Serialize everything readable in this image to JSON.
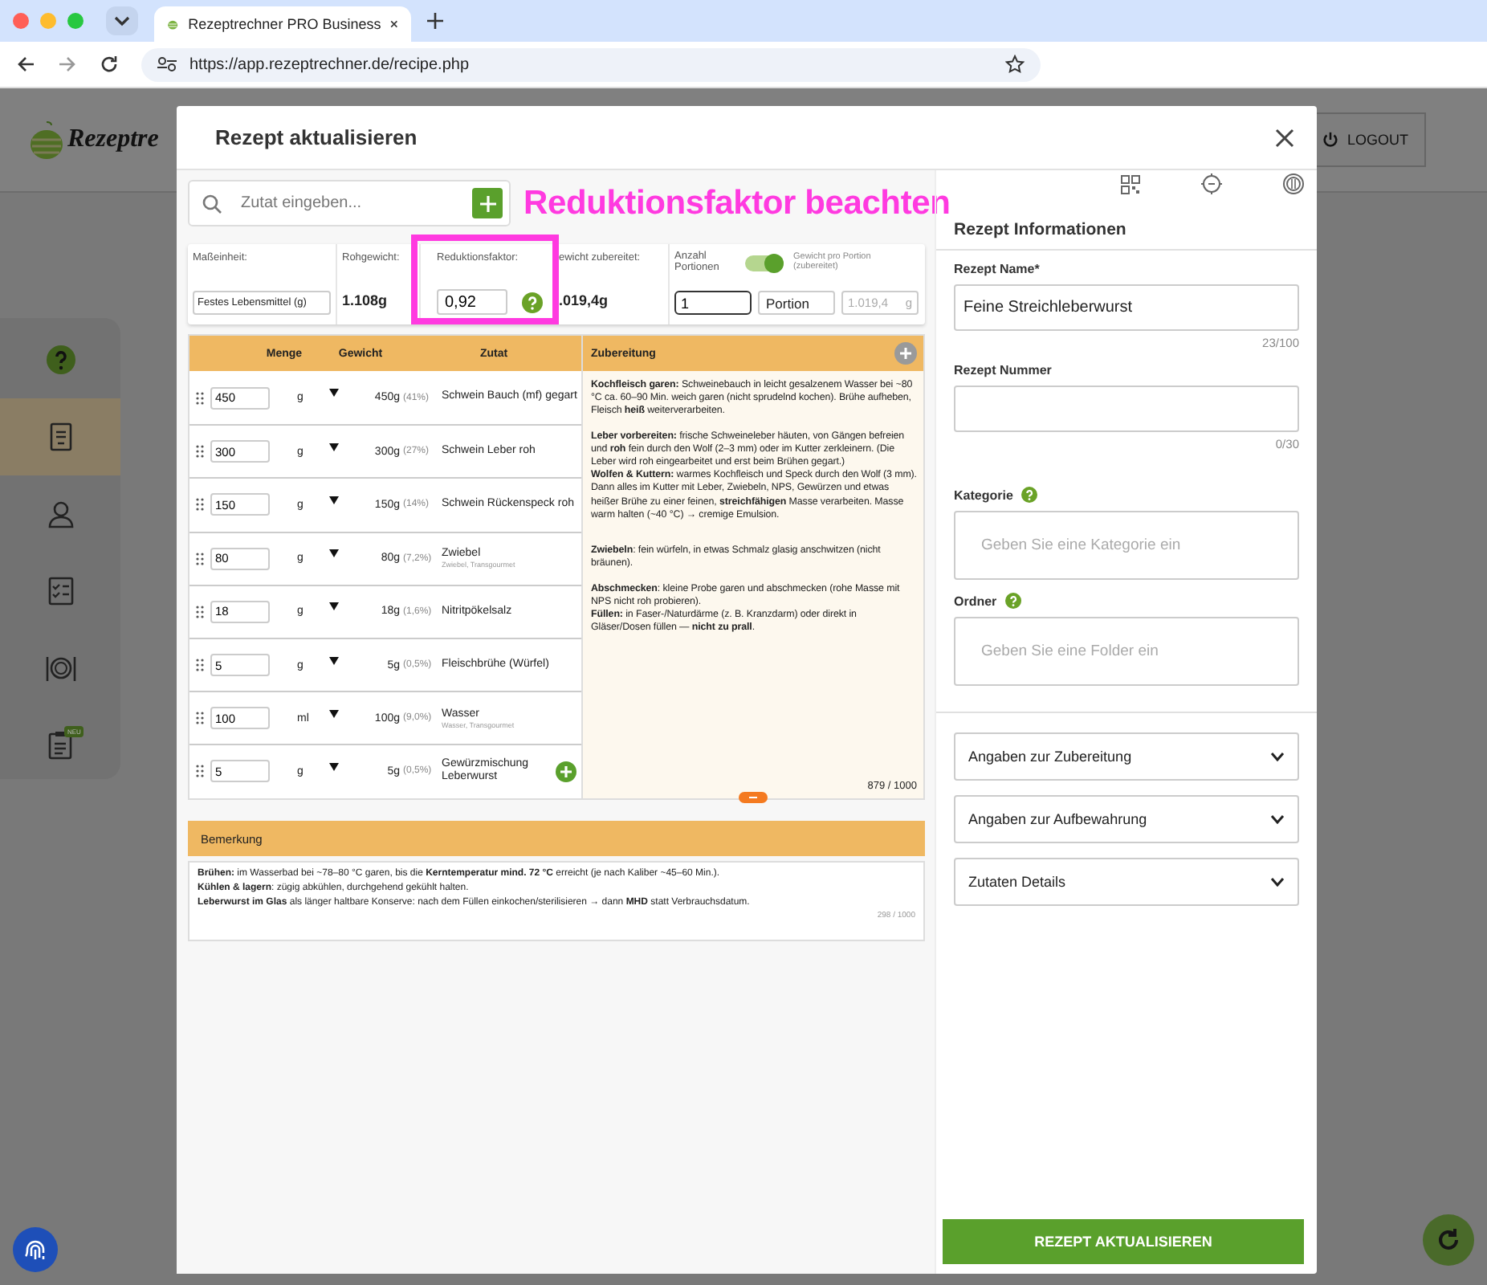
{
  "browser": {
    "tab_title": "Rezeptrechner PRO Business",
    "url": "https://app.rezeptrechner.de/recipe.php"
  },
  "app": {
    "logo_text": "Rezeptre",
    "logout": "LOGOUT",
    "sidebar": [
      {
        "selected": false
      },
      {
        "selected": true
      },
      {
        "selected": false
      },
      {
        "selected": false
      },
      {
        "selected": false
      },
      {
        "selected": false,
        "badge": "NEU"
      }
    ]
  },
  "modal": {
    "title": "Rezept aktualisieren",
    "search": {
      "placeholder": "Zutat eingeben..."
    },
    "annotation": "Reduktionsfaktor beachten",
    "summary": {
      "unit_label": "Maßeinheit:",
      "unit_value": "Festes Lebensmittel (g)",
      "raw_label": "Rohgewicht:",
      "raw_value": "1.108g",
      "factor_label": "Reduktionsfaktor:",
      "factor_value": "0,92",
      "factor_highlighted": true,
      "cooked_label": "ewicht zubereitet:",
      "cooked_value": ".019,4g",
      "portions_label": "Anzahl Portionen",
      "per_portion": {
        "on": true,
        "label": "Gewicht pro Portion (zubereitet)"
      },
      "portions_value": "1",
      "portion_unit": "Portion",
      "portion_weight": "1.019,4",
      "portion_weight_unit": "g"
    },
    "ingredients": {
      "columns": [
        "Menge",
        "Gewicht",
        "Zutat"
      ],
      "rows": [
        {
          "amount": "450",
          "unit": "g",
          "weight": "450g",
          "percent": "(41%)",
          "name": "Schwein Bauch (mf) gegart"
        },
        {
          "amount": "300",
          "unit": "g",
          "weight": "300g",
          "percent": "(27%)",
          "name": "Schwein Leber roh"
        },
        {
          "amount": "150",
          "unit": "g",
          "weight": "150g",
          "percent": "(14%)",
          "name": "Schwein Rückenspeck roh"
        },
        {
          "amount": "80",
          "unit": "g",
          "weight": "80g",
          "percent": "(7,2%)",
          "name": "Zwiebel",
          "source": "Zwiebel, Transgourmet"
        },
        {
          "amount": "18",
          "unit": "g",
          "weight": "18g",
          "percent": "(1,6%)",
          "name": "Nitritpökelsalz"
        },
        {
          "amount": "5",
          "unit": "g",
          "weight": "5g",
          "percent": "(0,5%)",
          "name": "Fleischbrühe (Würfel)"
        },
        {
          "amount": "100",
          "unit": "ml",
          "weight": "100g",
          "percent": "(9,0%)",
          "name": "Wasser",
          "source": "Wasser, Transgourmet"
        },
        {
          "amount": "5",
          "unit": "g",
          "weight": "5g",
          "percent": "(0,5%)",
          "name": "Gewürzmischung Leberwurst",
          "add_button": true
        }
      ]
    },
    "preparation": {
      "title": "Zubereitung",
      "blocks": [
        [
          "**Kochfleisch garen:** Schweinebauch in leicht gesalzenem Wasser bei ~80 °C ca. 60–90 Min. weich garen (nicht sprudelnd kochen). Brühe aufheben, Fleisch **heiß** weiterverarbeiten."
        ],
        [
          "**Leber vorbereiten:** frische Schweineleber häuten, von Gängen befreien und **roh** fein durch den Wolf (2–3 mm) oder im Kutter zerkleinern. (Die Leber wird roh eingearbeitet und erst beim Brühen gegart.)",
          "**Wolfen & Kuttern:** warmes Kochfleisch und Speck durch den Wolf (3 mm). Dann alles im Kutter mit Leber, Zwiebeln, NPS, Gewürzen und etwas heißer Brühe zu einer feinen, **streichfähigen** Masse verarbeiten. Masse warm halten (~40 °C) → cremige Emulsion."
        ],
        [
          "**Zwiebeln**: fein würfeln, in etwas Schmalz glasig anschwitzen (nicht bräunen)."
        ],
        [
          "**Abschmecken**: kleine Probe garen und abschmecken (rohe Masse mit NPS nicht roh probieren).",
          "**Füllen:** in Faser-/Naturdärme (z. B. Kranzdarm) oder direkt in Gläser/Dosen füllen — **nicht zu prall**."
        ]
      ],
      "counter": "879 / 1000"
    },
    "remark": {
      "title": "Bemerkung",
      "lines": [
        "**Brühen:** im Wasserbad bei ~78–80 °C garen, bis die **Kerntemperatur mind. 72 °C** erreicht (je nach Kaliber ~45–60 Min.).",
        "**Kühlen & lagern**: zügig abkühlen, durchgehend gekühlt halten.",
        "**Leberwurst im Glas** als länger haltbare Konserve: nach dem Füllen einkochen/sterilisieren → dann **MHD** statt Verbrauchsdatum."
      ],
      "counter": "298 / 1000"
    },
    "info": {
      "title": "Rezept Informationen",
      "fields": [
        {
          "label": "Rezept Name*",
          "value": "Feine Streichleberwurst",
          "counter": "23/100"
        },
        {
          "label": "Rezept Nummer",
          "counter": "0/30"
        },
        {
          "label": "Kategorie",
          "help": true,
          "placeholder": "Geben Sie eine Kategorie ein"
        },
        {
          "label": "Ordner",
          "help": true,
          "placeholder": "Geben Sie eine Folder ein"
        }
      ],
      "sections": [
        {
          "label": "Angaben zur Zubereitung",
          "expanded": false
        },
        {
          "label": "Angaben zur Aufbewahrung",
          "expanded": false
        },
        {
          "label": "Zutaten Details",
          "expanded": false
        }
      ],
      "submit": "REZEPT AKTUALISIEREN"
    }
  }
}
